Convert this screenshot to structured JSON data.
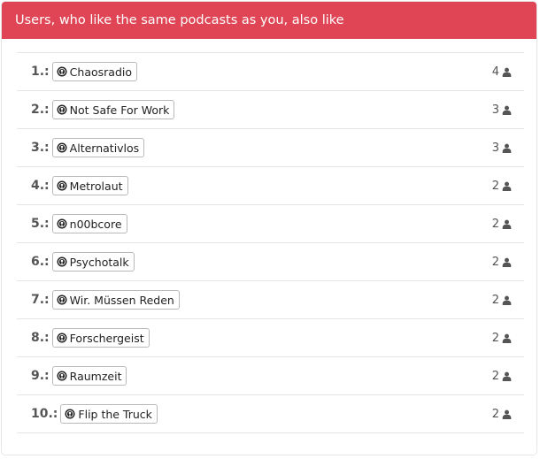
{
  "header": {
    "title": "Users, who like the same podcasts as you, also like"
  },
  "items": [
    {
      "rank": "1.:",
      "name": "Chaosradio",
      "count": "4"
    },
    {
      "rank": "2.:",
      "name": "Not Safe For Work",
      "count": "3"
    },
    {
      "rank": "3.:",
      "name": "Alternativlos",
      "count": "3"
    },
    {
      "rank": "4.:",
      "name": "Metrolaut",
      "count": "2"
    },
    {
      "rank": "5.:",
      "name": "n00bcore",
      "count": "2"
    },
    {
      "rank": "6.:",
      "name": "Psychotalk",
      "count": "2"
    },
    {
      "rank": "7.:",
      "name": "Wir. Müssen Reden",
      "count": "2"
    },
    {
      "rank": "8.:",
      "name": "Forschergeist",
      "count": "2"
    },
    {
      "rank": "9.:",
      "name": "Raumzeit",
      "count": "2"
    },
    {
      "rank": "10.:",
      "name": "Flip the Truck",
      "count": "2"
    }
  ],
  "icons": {
    "podcast": "podcast-icon",
    "user": "user-icon"
  },
  "colors": {
    "header_bg": "#df4554"
  }
}
